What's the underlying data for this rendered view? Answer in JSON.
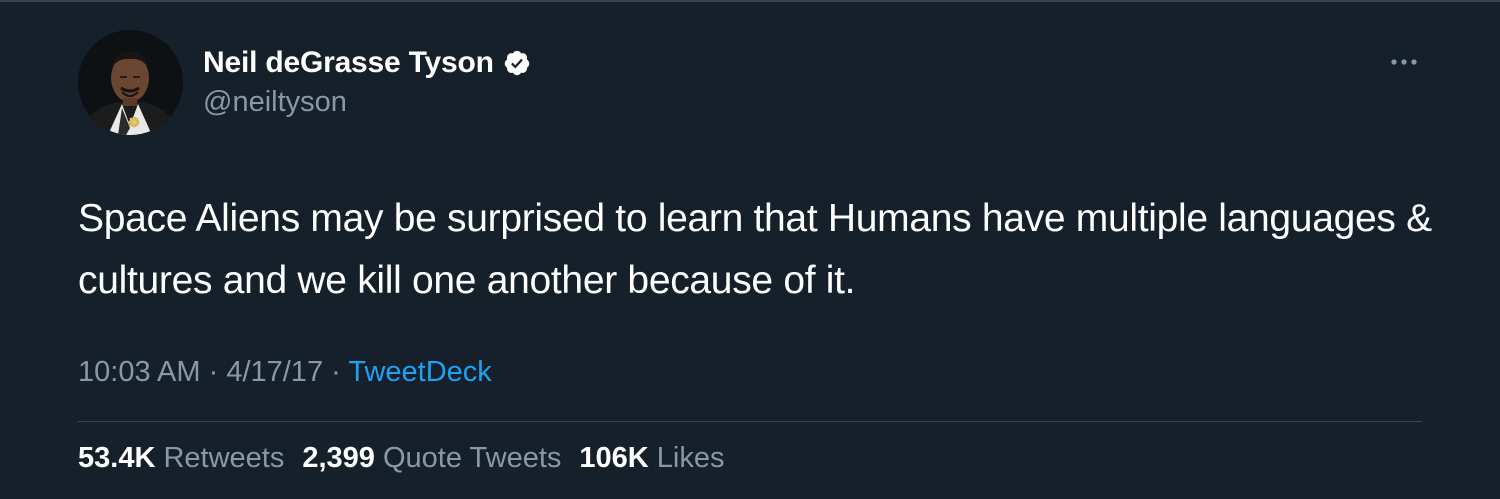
{
  "tweet": {
    "author": {
      "display_name": "Neil deGrasse Tyson",
      "handle": "@neiltyson",
      "verified_icon": "verified-badge-icon"
    },
    "more_icon": "more-options-icon",
    "text": "Space Aliens may be surprised to learn that Humans have multiple languages & cultures and we kill one another because of it.",
    "time": "10:03 AM",
    "separator": " · ",
    "date": "4/17/17",
    "source": "TweetDeck",
    "stats": {
      "retweets": {
        "count": "53.4K",
        "label": "Retweets"
      },
      "quote_tweets": {
        "count": "2,399",
        "label": "Quote Tweets"
      },
      "likes": {
        "count": "106K",
        "label": "Likes"
      }
    }
  },
  "colors": {
    "background": "#15202b",
    "text_primary": "#ffffff",
    "text_secondary": "#8899a6",
    "link": "#1da1f2",
    "divider": "#38444d"
  }
}
